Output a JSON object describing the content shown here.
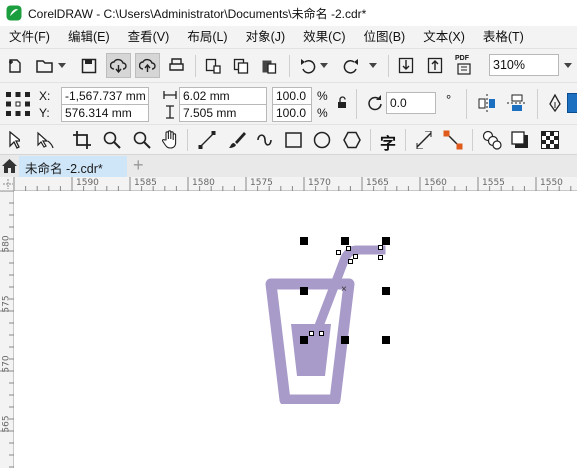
{
  "window": {
    "title": "CorelDRAW - C:\\Users\\Administrator\\Documents\\未命名 -2.cdr*"
  },
  "menu": [
    "文件(F)",
    "编辑(E)",
    "查看(V)",
    "布局(L)",
    "对象(J)",
    "效果(C)",
    "位图(B)",
    "文本(X)",
    "表格(T)"
  ],
  "toolbar": {
    "zoom_value": "310%",
    "pdf_label": "PDF"
  },
  "property_bar": {
    "x_label": "X:",
    "x_value": "-1,567.737 mm",
    "y_label": "Y:",
    "y_value": "576.314 mm",
    "width_value": "6.02 mm",
    "height_value": "7.505 mm",
    "scale_x": "100.0",
    "scale_y": "100.0",
    "percent": "%",
    "rotation_value": "0.0",
    "degree": "°"
  },
  "toolbox": {
    "text_tool": "字"
  },
  "document_tab": {
    "name": "未命名 -2.cdr*",
    "add": "+"
  },
  "ruler": {
    "top_ticks": [
      "1590",
      "1585",
      "1580",
      "1575",
      "1570",
      "1565",
      "1560",
      "1555",
      "1550"
    ],
    "left_ticks": [
      "580",
      "575",
      "570",
      "565"
    ]
  },
  "colors": {
    "cup_fill": "#a89bc9",
    "menu_bg": "#f3f3f3",
    "tab_active": "#cfe6f9"
  }
}
